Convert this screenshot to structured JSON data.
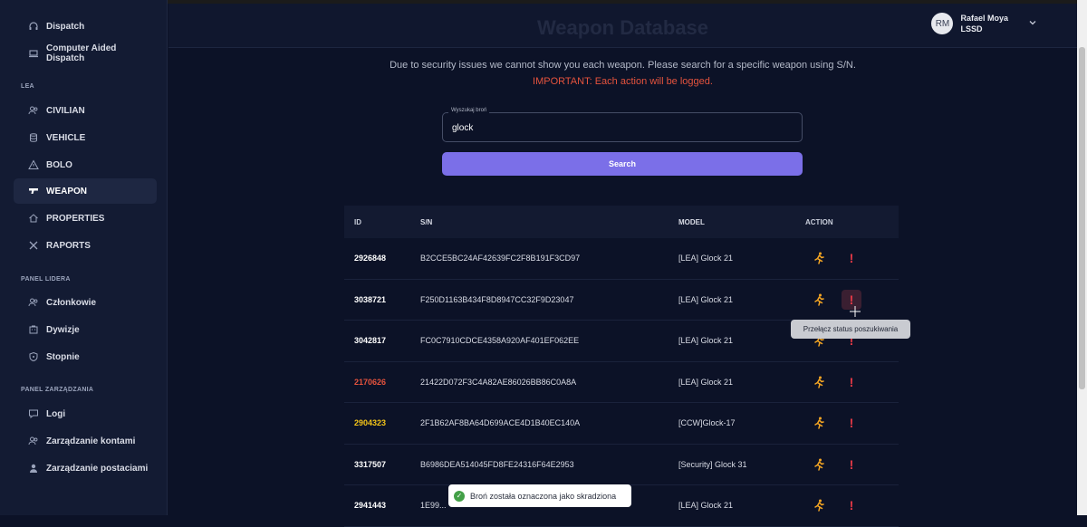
{
  "sidebar": {
    "top_items": [
      {
        "label": "Dispatch",
        "icon": "headset-icon"
      },
      {
        "label": "Computer Aided Dispatch",
        "icon": "laptop-icon"
      }
    ],
    "sections": [
      {
        "title": "LEA",
        "items": [
          {
            "label": "CIVILIAN",
            "icon": "users-icon"
          },
          {
            "label": "VEHICLE",
            "icon": "database-icon"
          },
          {
            "label": "BOLO",
            "icon": "warning-icon"
          },
          {
            "label": "WEAPON",
            "icon": "gun-icon",
            "active": true
          },
          {
            "label": "PROPERTIES",
            "icon": "home-icon"
          },
          {
            "label": "RAPORTS",
            "icon": "wrench-icon"
          }
        ]
      },
      {
        "title": "PANEL LIDERA",
        "items": [
          {
            "label": "Członkowie",
            "icon": "users-icon"
          },
          {
            "label": "Dywizje",
            "icon": "building-icon"
          },
          {
            "label": "Stopnie",
            "icon": "shield-icon"
          }
        ]
      },
      {
        "title": "PANEL ZARZĄDZANIA",
        "items": [
          {
            "label": "Logi",
            "icon": "chat-icon"
          },
          {
            "label": "Zarządzanie kontami",
            "icon": "users-icon"
          },
          {
            "label": "Zarządzanie postaciami",
            "icon": "person-icon"
          }
        ]
      }
    ]
  },
  "header": {
    "title": "Weapon Database",
    "user": {
      "initials": "RM",
      "name": "Rafael Moya",
      "unit": "LSSD"
    }
  },
  "notices": {
    "info": "Due to security issues we cannot show you each weapon. Please search for a specific weapon using S/N.",
    "warning": "IMPORTANT: Each action will be logged."
  },
  "search": {
    "label": "Wyszukaj broń",
    "value": "glock",
    "button": "Search"
  },
  "table": {
    "columns": [
      "ID",
      "S/N",
      "MODEL",
      "ACTION"
    ],
    "rows": [
      {
        "id": "2926848",
        "sn": "B2CCE5BC24AF42639FC2F8B191F3CD97",
        "model": "[LEA] Glock 21",
        "id_color": "#ffffff"
      },
      {
        "id": "3038721",
        "sn": "F250D1163B434F8D8947CC32F9D23047",
        "model": "[LEA] Glock 21",
        "id_color": "#ffffff",
        "hover": true
      },
      {
        "id": "3042817",
        "sn": "FC0C7910CDCE4358A920AF401EF062EE",
        "model": "[LEA] Glock 21",
        "id_color": "#ffffff"
      },
      {
        "id": "2170626",
        "sn": "21422D072F3C4A82AE86026BB86C0A8A",
        "model": "[LEA] Glock 21",
        "id_color": "#e5533d"
      },
      {
        "id": "2904323",
        "sn": "2F1B62AF8BA64D699ACE4D1B40EC140A",
        "model": "[CCW]Glock-17",
        "id_color": "#f5c518"
      },
      {
        "id": "3317507",
        "sn": "B6986DEA514045FD8FE24316F64E2953",
        "model": "[Security] Glock 31",
        "id_color": "#ffffff"
      },
      {
        "id": "2941443",
        "sn": "1E99...",
        "model": "[LEA] Glock 21",
        "id_color": "#ffffff"
      }
    ]
  },
  "tooltip": "Przełącz status poszukiwania",
  "toast": "Broń została oznaczona jako skradziona",
  "colors": {
    "accent": "#7b6fe8",
    "warning": "#e5533d",
    "stolen": "#e5533d",
    "wanted": "#f5c518"
  }
}
